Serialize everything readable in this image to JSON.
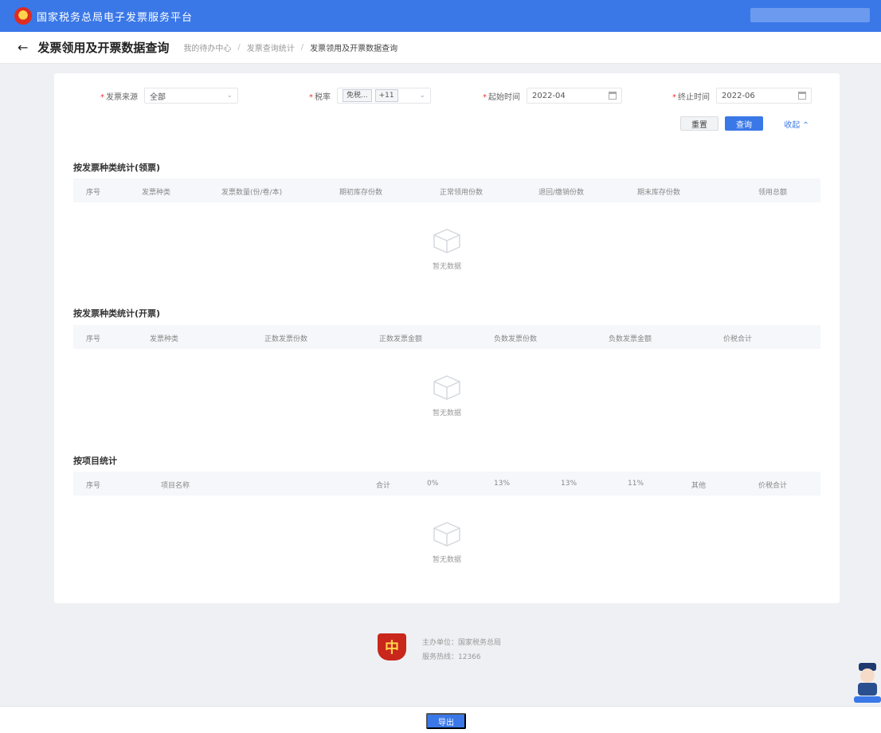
{
  "header": {
    "platform_title": "国家税务总局电子发票服务平台"
  },
  "page": {
    "title": "发票领用及开票数据查询",
    "breadcrumbs": [
      "我的待办中心",
      "发票查询统计",
      "发票领用及开票数据查询"
    ]
  },
  "filters": {
    "invoice_source": {
      "label": "发票来源",
      "value": "全部"
    },
    "tax_rate": {
      "label": "税率",
      "tag": "免税...",
      "extra": "+11"
    },
    "start_time": {
      "label": "起始时间",
      "value": "2022-04"
    },
    "end_time": {
      "label": "终止时间",
      "value": "2022-06"
    }
  },
  "buttons": {
    "reset": "重置",
    "query": "查询",
    "collapse": "收起 ⌃"
  },
  "sections": [
    {
      "title": "按发票种类统计(领票)",
      "columns": [
        "序号",
        "发票种类",
        "发票数量(份/卷/本)",
        "期初库存份数",
        "正常领用份数",
        "退回/缴销份数",
        "期末库存份数",
        "领用总额"
      ],
      "empty": "暂无数据"
    },
    {
      "title": "按发票种类统计(开票)",
      "columns": [
        "序号",
        "发票种类",
        "正数发票份数",
        "正数发票金额",
        "负数发票份数",
        "负数发票金额",
        "价税合计"
      ],
      "empty": "暂无数据"
    },
    {
      "title": "按项目统计",
      "columns": [
        "序号",
        "项目名称",
        "合计",
        "0%",
        "13%",
        "13%",
        "11%",
        "其他",
        "价税合计"
      ],
      "empty": "暂无数据"
    }
  ],
  "footer": {
    "line1": "主办单位：国家税务总局",
    "line2": "服务热线：12366"
  },
  "bottom": {
    "button": "导出"
  }
}
